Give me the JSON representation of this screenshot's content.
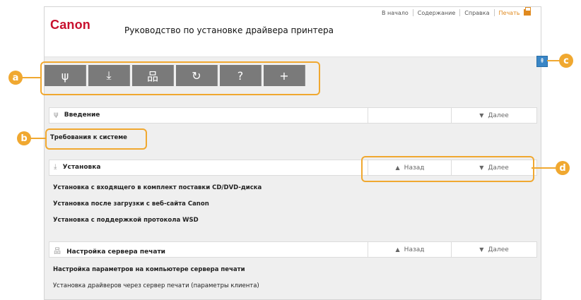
{
  "header": {
    "brand": "Canon",
    "title": "Руководство по установке драйвера принтера",
    "links": [
      "В начало",
      "Содержание",
      "Справка"
    ],
    "print_label": "Печать"
  },
  "toolbar": {
    "icons": [
      "sprout-icon",
      "download-icon",
      "network-icon",
      "refresh-icon",
      "help-icon",
      "plus-icon"
    ],
    "glyphs": [
      "ψ",
      "⤓",
      "品",
      "↻",
      "?",
      "+"
    ]
  },
  "back_to_top_glyph": "⇞",
  "sections": [
    {
      "title": "Введение",
      "prev": "",
      "next": "Далее",
      "items": [
        "Требования к системе"
      ]
    },
    {
      "title": "Установка",
      "prev": "Назад",
      "next": "Далее",
      "items": [
        "Установка с входящего в комплект поставки CD/DVD-диска",
        "Установка после загрузки с веб-сайта Canon",
        "Установка с поддержкой протокола WSD"
      ]
    },
    {
      "title": "Настройка сервера печати",
      "prev": "Назад",
      "next": "Далее",
      "items": [
        "Настройка параметров на компьютере сервера печати",
        "Установка драйверов через сервер печати (параметры клиента)"
      ]
    }
  ],
  "annotations": [
    "a",
    "b",
    "c",
    "d"
  ],
  "colors": {
    "accent": "#f0a830",
    "brand": "#c8102e",
    "toolbar": "#7a7a7a",
    "top_button": "#3a86c6"
  }
}
